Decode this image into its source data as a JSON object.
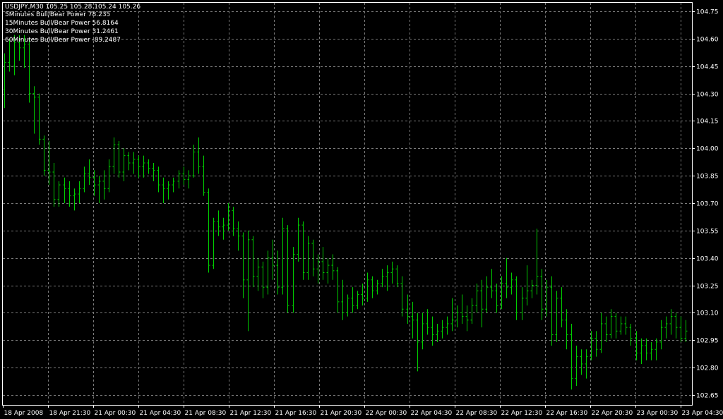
{
  "header": {
    "symbol_line": "USDJPY,M30  105.25 105.28 105.24 105.26",
    "indicators": [
      "5Minutes Bull/Bear Power 78.235",
      "15Minutes Bull/Bear Power 56.8164",
      "30Minutes Bull/Bear Power 31.2461",
      "60Minutes Bull/Bear Power -89.2487"
    ]
  },
  "colors": {
    "background": "#000000",
    "bars": "#00cc00",
    "grid": "#7a7a7a",
    "frame": "#ffffff",
    "text": "#ffffff"
  },
  "chart_data": {
    "type": "ohlc",
    "symbol": "USDJPY",
    "timeframe": "M30",
    "ylim": [
      102.55,
      104.8
    ],
    "y_ticks": [
      "104.75",
      "104.60",
      "104.45",
      "104.30",
      "104.15",
      "104.00",
      "103.85",
      "103.70",
      "103.55",
      "103.40",
      "103.25",
      "103.10",
      "102.95",
      "102.80",
      "102.65"
    ],
    "y_tick_values": [
      104.75,
      104.6,
      104.45,
      104.3,
      104.15,
      104.0,
      103.85,
      103.7,
      103.55,
      103.4,
      103.25,
      103.1,
      102.95,
      102.8,
      102.65
    ],
    "x_ticks": [
      "18 Apr 2008",
      "18 Apr 21:30",
      "21 Apr 00:30",
      "21 Apr 04:30",
      "21 Apr 08:30",
      "21 Apr 12:30",
      "21 Apr 16:30",
      "21 Apr 20:30",
      "22 Apr 00:30",
      "22 Apr 04:30",
      "22 Apr 08:30",
      "22 Apr 12:30",
      "22 Apr 16:30",
      "22 Apr 20:30",
      "23 Apr 00:30",
      "23 Apr 04:30"
    ],
    "grid": true,
    "bars": [
      [
        104.32,
        104.52,
        104.22,
        104.47
      ],
      [
        104.47,
        104.6,
        104.42,
        104.45
      ],
      [
        104.45,
        104.62,
        104.4,
        104.58
      ],
      [
        104.58,
        104.62,
        104.48,
        104.55
      ],
      [
        104.55,
        104.62,
        104.44,
        104.57
      ],
      [
        104.57,
        104.6,
        104.25,
        104.3
      ],
      [
        104.3,
        104.34,
        104.08,
        104.28
      ],
      [
        104.28,
        104.3,
        104.02,
        104.05
      ],
      [
        104.05,
        104.07,
        103.85,
        103.88
      ],
      [
        103.88,
        104.04,
        103.8,
        103.87
      ],
      [
        103.87,
        103.92,
        103.68,
        103.72
      ],
      [
        103.72,
        103.82,
        103.68,
        103.8
      ],
      [
        103.8,
        103.84,
        103.7,
        103.78
      ],
      [
        103.78,
        103.82,
        103.68,
        103.74
      ],
      [
        103.74,
        103.78,
        103.66,
        103.75
      ],
      [
        103.75,
        103.82,
        103.7,
        103.78
      ],
      [
        103.78,
        103.9,
        103.76,
        103.86
      ],
      [
        103.86,
        103.94,
        103.8,
        103.84
      ],
      [
        103.84,
        103.88,
        103.74,
        103.8
      ],
      [
        103.8,
        103.85,
        103.7,
        103.82
      ],
      [
        103.82,
        103.88,
        103.72,
        103.78
      ],
      [
        103.78,
        103.94,
        103.76,
        103.9
      ],
      [
        103.9,
        104.06,
        103.86,
        104.02
      ],
      [
        104.02,
        104.04,
        103.84,
        103.87
      ],
      [
        103.87,
        104.0,
        103.82,
        103.96
      ],
      [
        103.96,
        103.98,
        103.88,
        103.92
      ],
      [
        103.92,
        103.98,
        103.86,
        103.94
      ],
      [
        103.94,
        103.96,
        103.84,
        103.9
      ],
      [
        103.9,
        103.96,
        103.84,
        103.92
      ],
      [
        103.92,
        103.94,
        103.86,
        103.89
      ],
      [
        103.89,
        103.92,
        103.82,
        103.88
      ],
      [
        103.88,
        103.9,
        103.76,
        103.8
      ],
      [
        103.8,
        103.84,
        103.7,
        103.78
      ],
      [
        103.78,
        103.82,
        103.72,
        103.8
      ],
      [
        103.8,
        103.84,
        103.76,
        103.82
      ],
      [
        103.82,
        103.88,
        103.78,
        103.86
      ],
      [
        103.86,
        103.9,
        103.8,
        103.83
      ],
      [
        103.83,
        103.88,
        103.78,
        103.85
      ],
      [
        103.85,
        104.02,
        103.84,
        103.98
      ],
      [
        103.98,
        104.06,
        103.86,
        103.9
      ],
      [
        103.9,
        103.96,
        103.74,
        103.76
      ],
      [
        103.76,
        103.78,
        103.32,
        103.36
      ],
      [
        103.36,
        103.62,
        103.34,
        103.6
      ],
      [
        103.6,
        103.66,
        103.52,
        103.57
      ],
      [
        103.57,
        103.62,
        103.5,
        103.58
      ],
      [
        103.58,
        103.7,
        103.55,
        103.66
      ],
      [
        103.66,
        103.68,
        103.52,
        103.56
      ],
      [
        103.56,
        103.6,
        103.44,
        103.52
      ],
      [
        103.52,
        103.54,
        103.18,
        103.28
      ],
      [
        103.28,
        103.55,
        103.0,
        103.5
      ],
      [
        103.5,
        103.52,
        103.24,
        103.3
      ],
      [
        103.3,
        103.4,
        103.22,
        103.35
      ],
      [
        103.35,
        103.38,
        103.18,
        103.24
      ],
      [
        103.24,
        103.44,
        103.2,
        103.4
      ],
      [
        103.4,
        103.5,
        103.28,
        103.36
      ],
      [
        103.36,
        103.44,
        103.2,
        103.24
      ],
      [
        103.24,
        103.62,
        103.2,
        103.56
      ],
      [
        103.56,
        103.58,
        103.1,
        103.14
      ],
      [
        103.14,
        103.46,
        103.1,
        103.42
      ],
      [
        103.42,
        103.62,
        103.38,
        103.58
      ],
      [
        103.58,
        103.6,
        103.28,
        103.32
      ],
      [
        103.32,
        103.52,
        103.28,
        103.48
      ],
      [
        103.48,
        103.5,
        103.3,
        103.34
      ],
      [
        103.34,
        103.42,
        103.26,
        103.38
      ],
      [
        103.38,
        103.46,
        103.28,
        103.32
      ],
      [
        103.32,
        103.4,
        103.26,
        103.36
      ],
      [
        103.36,
        103.42,
        103.28,
        103.33
      ],
      [
        103.33,
        103.35,
        103.1,
        103.16
      ],
      [
        103.16,
        103.28,
        103.06,
        103.1
      ],
      [
        103.1,
        103.2,
        103.08,
        103.18
      ],
      [
        103.18,
        103.24,
        103.1,
        103.14
      ],
      [
        103.14,
        103.22,
        103.12,
        103.2
      ],
      [
        103.2,
        103.26,
        103.14,
        103.18
      ],
      [
        103.18,
        103.32,
        103.16,
        103.28
      ],
      [
        103.28,
        103.3,
        103.18,
        103.22
      ],
      [
        103.22,
        103.28,
        103.2,
        103.26
      ],
      [
        103.26,
        103.34,
        103.24,
        103.3
      ],
      [
        103.3,
        103.36,
        103.22,
        103.32
      ],
      [
        103.32,
        103.38,
        103.26,
        103.34
      ],
      [
        103.34,
        103.36,
        103.24,
        103.26
      ],
      [
        103.26,
        103.3,
        103.08,
        103.12
      ],
      [
        103.12,
        103.2,
        103.04,
        103.08
      ],
      [
        103.08,
        103.16,
        102.96,
        103.06
      ],
      [
        103.06,
        103.1,
        102.78,
        102.94
      ],
      [
        102.94,
        103.1,
        102.9,
        103.04
      ],
      [
        103.04,
        103.12,
        102.98,
        103.02
      ],
      [
        103.02,
        103.08,
        102.92,
        102.98
      ],
      [
        102.98,
        103.04,
        102.94,
        103.0
      ],
      [
        103.0,
        103.06,
        102.96,
        103.02
      ],
      [
        103.02,
        103.08,
        102.98,
        103.04
      ],
      [
        103.04,
        103.18,
        103.0,
        103.06
      ],
      [
        103.06,
        103.14,
        103.02,
        103.1
      ],
      [
        103.1,
        103.2,
        103.04,
        103.08
      ],
      [
        103.08,
        103.14,
        103.0,
        103.06
      ],
      [
        103.06,
        103.18,
        103.04,
        103.14
      ],
      [
        103.14,
        103.26,
        103.1,
        103.22
      ],
      [
        103.22,
        103.28,
        103.02,
        103.12
      ],
      [
        103.12,
        103.3,
        103.1,
        103.24
      ],
      [
        103.24,
        103.34,
        103.18,
        103.22
      ],
      [
        103.22,
        103.26,
        103.1,
        103.14
      ],
      [
        103.14,
        103.3,
        103.12,
        103.26
      ],
      [
        103.26,
        103.4,
        103.18,
        103.24
      ],
      [
        103.24,
        103.32,
        103.2,
        103.28
      ],
      [
        103.28,
        103.3,
        103.06,
        103.1
      ],
      [
        103.1,
        103.24,
        103.06,
        103.18
      ],
      [
        103.18,
        103.36,
        103.14,
        103.22
      ],
      [
        103.22,
        103.28,
        103.18,
        103.25
      ],
      [
        103.25,
        103.56,
        103.2,
        103.3
      ],
      [
        103.3,
        103.34,
        103.06,
        103.12
      ],
      [
        103.12,
        103.28,
        103.08,
        103.24
      ],
      [
        103.24,
        103.3,
        102.92,
        102.98
      ],
      [
        102.98,
        103.22,
        102.94,
        103.18
      ],
      [
        103.18,
        103.24,
        103.02,
        103.06
      ],
      [
        103.06,
        103.12,
        102.9,
        102.98
      ],
      [
        102.98,
        103.04,
        102.68,
        102.74
      ],
      [
        102.74,
        102.92,
        102.7,
        102.86
      ],
      [
        102.86,
        102.9,
        102.76,
        102.82
      ],
      [
        102.82,
        102.9,
        102.74,
        102.86
      ],
      [
        102.86,
        103.0,
        102.84,
        102.96
      ],
      [
        102.96,
        103.0,
        102.86,
        102.9
      ],
      [
        102.9,
        103.1,
        102.88,
        103.04
      ],
      [
        103.04,
        103.08,
        102.94,
        102.98
      ],
      [
        102.98,
        103.12,
        102.96,
        103.08
      ],
      [
        103.08,
        103.1,
        102.96,
        103.0
      ],
      [
        103.0,
        103.08,
        102.98,
        103.04
      ],
      [
        103.04,
        103.08,
        102.98,
        103.02
      ],
      [
        103.02,
        103.04,
        102.92,
        102.96
      ],
      [
        102.96,
        103.0,
        102.84,
        102.88
      ],
      [
        102.88,
        102.96,
        102.82,
        102.92
      ],
      [
        102.92,
        102.96,
        102.84,
        102.88
      ],
      [
        102.88,
        102.94,
        102.84,
        102.9
      ],
      [
        102.9,
        102.96,
        102.84,
        102.94
      ],
      [
        102.94,
        103.06,
        102.9,
        103.02
      ],
      [
        103.02,
        103.08,
        102.96,
        103.04
      ],
      [
        103.04,
        103.12,
        102.98,
        103.08
      ],
      [
        103.08,
        103.1,
        102.96,
        103.02
      ],
      [
        103.02,
        103.08,
        102.94,
        102.96
      ],
      [
        102.96,
        103.06,
        102.94,
        103.0
      ]
    ]
  }
}
